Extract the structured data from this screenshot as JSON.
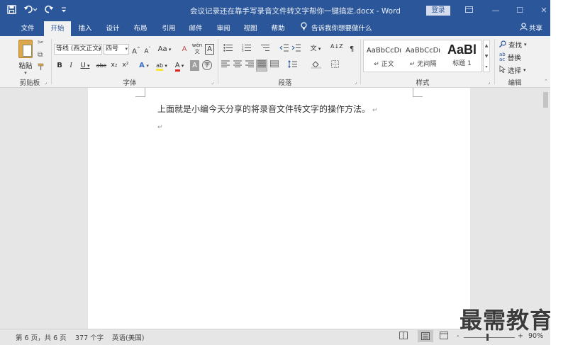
{
  "titlebar": {
    "title": "会议记录还在靠手写录音文件转文字帮你一键搞定.docx - Word",
    "login": "登录",
    "qat_icons": [
      "save-icon",
      "undo-icon",
      "redo-icon",
      "customize-qat-icon"
    ]
  },
  "tabs": [
    {
      "label": "文件"
    },
    {
      "label": "开始"
    },
    {
      "label": "插入"
    },
    {
      "label": "设计"
    },
    {
      "label": "布局"
    },
    {
      "label": "引用"
    },
    {
      "label": "邮件"
    },
    {
      "label": "审阅"
    },
    {
      "label": "视图"
    },
    {
      "label": "帮助"
    }
  ],
  "active_tab": "开始",
  "tell_me": "告诉我你想要做什么",
  "share": "共享",
  "ribbon": {
    "clipboard": {
      "paste": "粘贴",
      "label": "剪贴板"
    },
    "font": {
      "font_name": "等线 (西文正文)",
      "font_size": "四号",
      "label": "字体",
      "grow": "A",
      "shrink": "A",
      "case": "Aa",
      "clear": "A",
      "phonetic": "wén",
      "border": "A",
      "bold": "B",
      "italic": "I",
      "underline": "U",
      "strike": "abc",
      "sub": "x₂",
      "sup": "x²",
      "effect": "A",
      "highlight": "ab",
      "color": "A",
      "shade": "A",
      "enclose": "字"
    },
    "paragraph": {
      "label": "段落",
      "sort": "A↓Z",
      "marks": "¶"
    },
    "styles": {
      "label": "样式",
      "items": [
        {
          "sample": "AaBbCcDı",
          "name": "↵ 正文"
        },
        {
          "sample": "AaBbCcDı",
          "name": "↵ 无间隔"
        },
        {
          "sample": "AaBl",
          "name": "标题 1"
        }
      ]
    },
    "editing": {
      "label": "编辑",
      "find": "查找",
      "replace": "替换",
      "select": "选择"
    }
  },
  "document": {
    "line1": "上面就是小编今天分享的将录音文件转文字的操作方法。",
    "para_mark": "↵"
  },
  "status": {
    "page": "第 6 页，共 6 页",
    "words": "377 个字",
    "language": "英语(美国)",
    "zoom_minus": "-",
    "zoom_plus": "+",
    "zoom": "90%"
  },
  "watermark": "最需教育",
  "colors": {
    "accent": "#2b579a",
    "ribbon_bg": "#f1f1f1",
    "workspace": "#e6e6e6"
  }
}
